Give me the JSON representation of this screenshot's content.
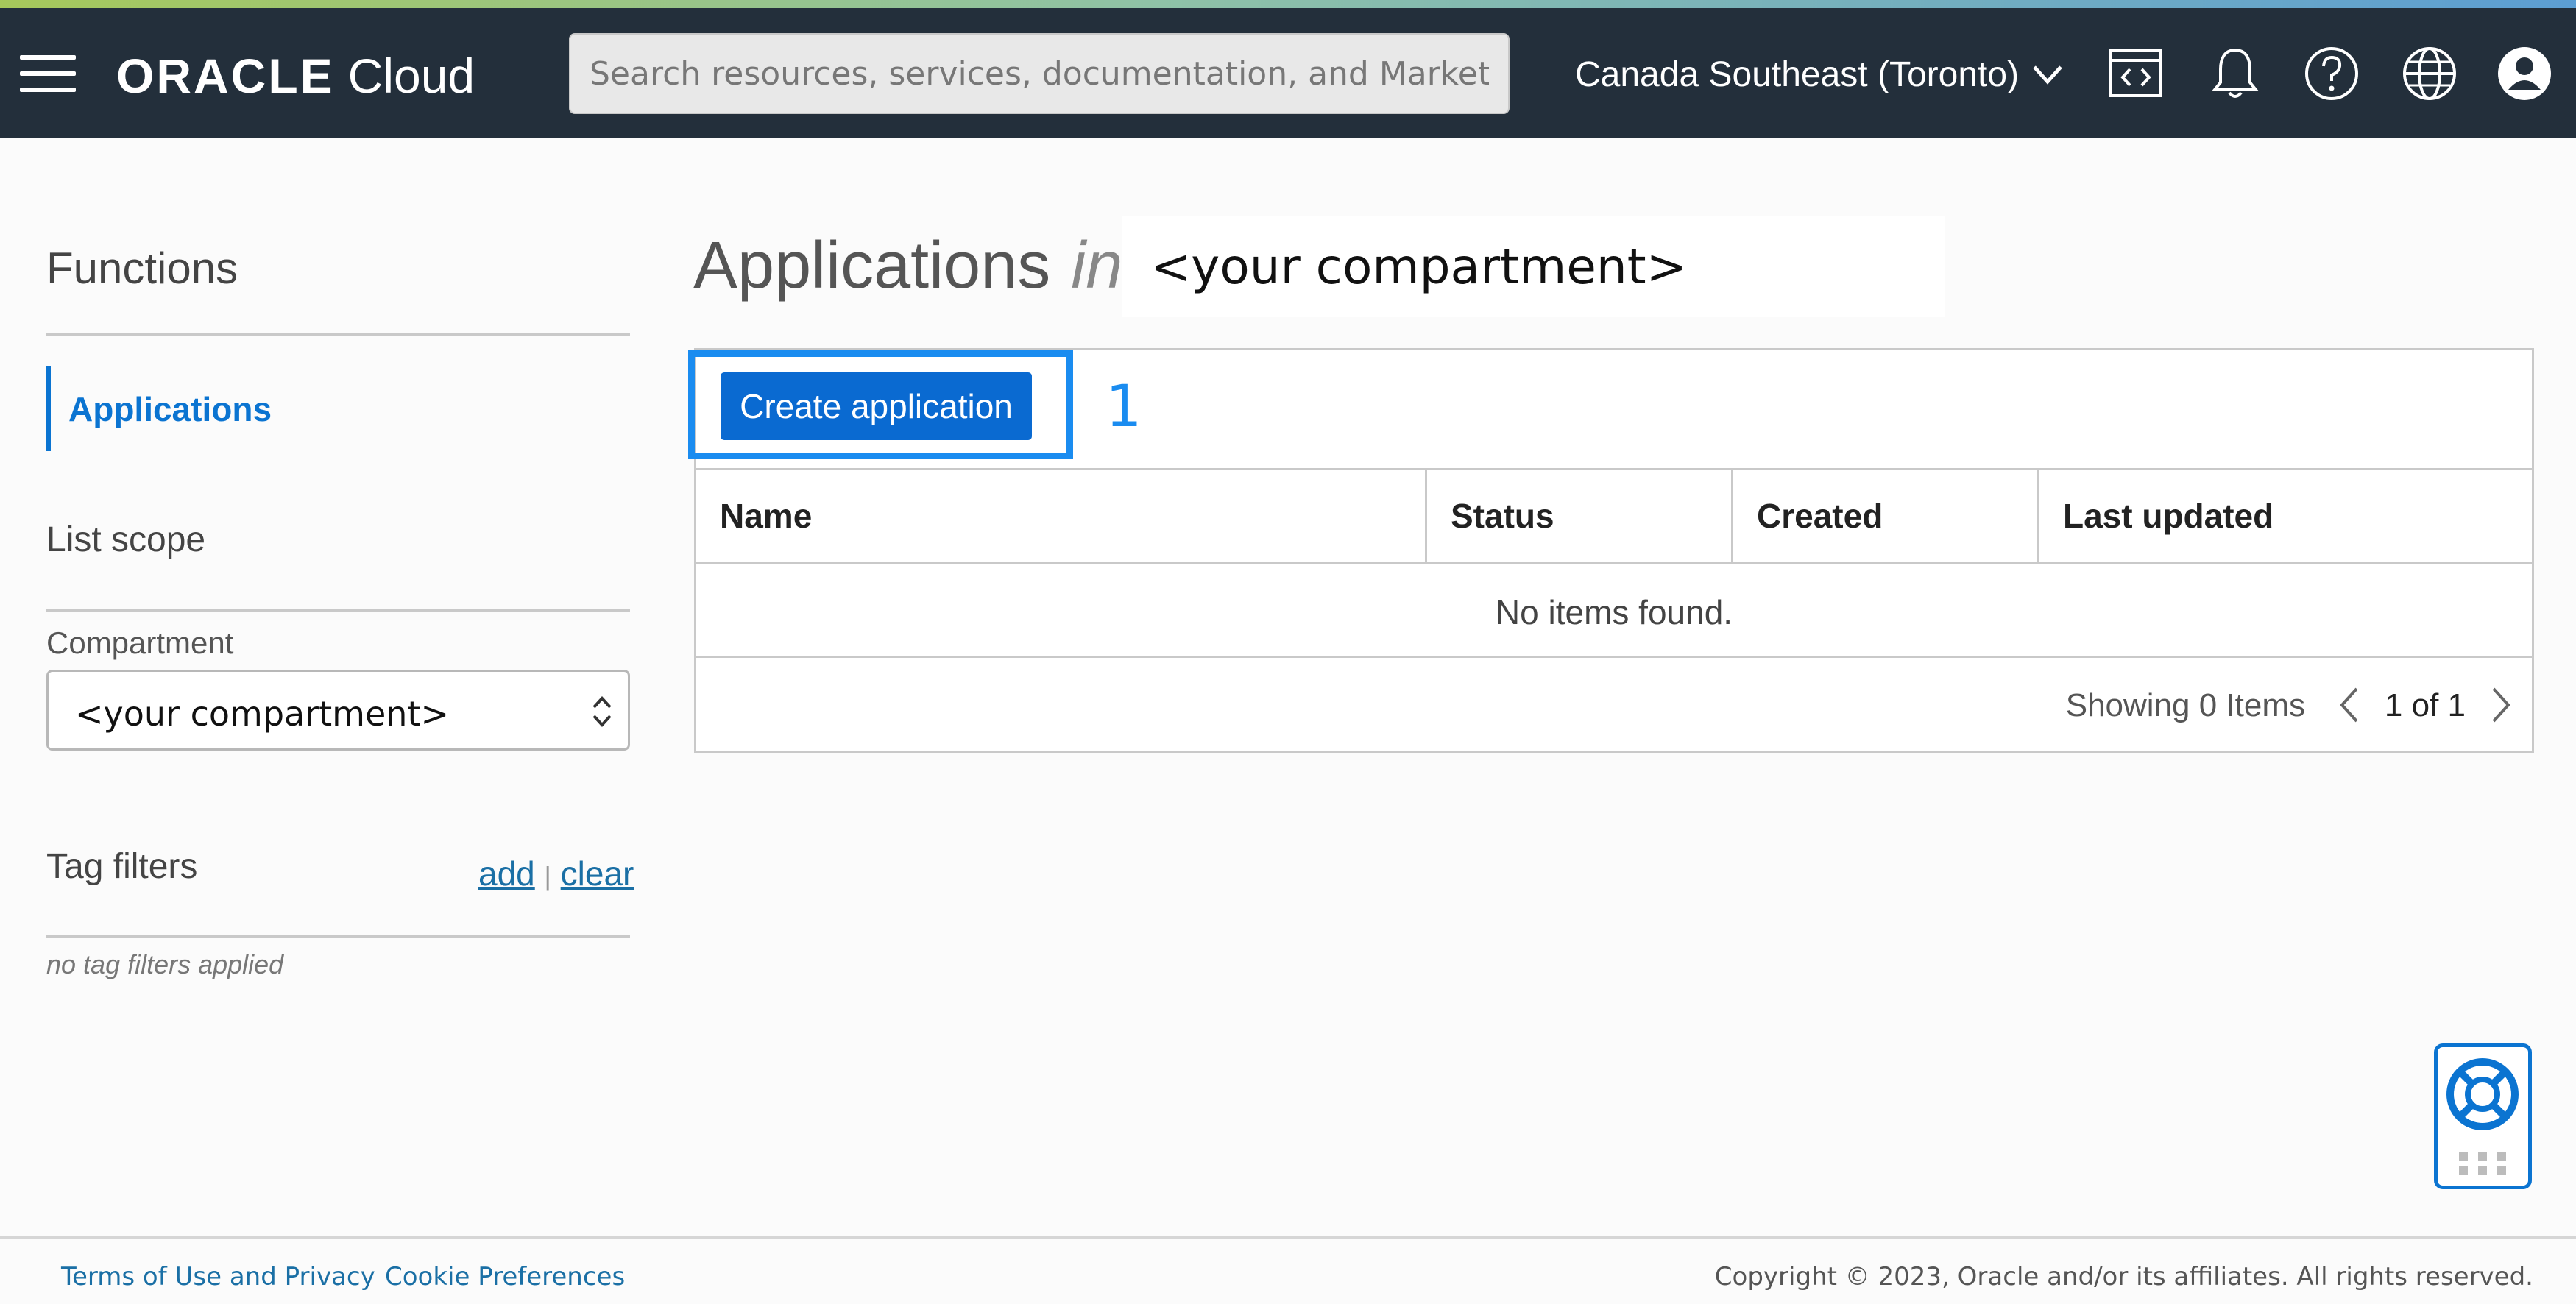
{
  "header": {
    "logo_text": "ORACLE",
    "logo_product": "Cloud",
    "search_placeholder": "Search resources, services, documentation, and Marketplace",
    "region": "Canada Southeast (Toronto)",
    "icons": [
      "code-editor-icon",
      "bell-icon",
      "help-icon",
      "globe-icon",
      "user-icon"
    ]
  },
  "sidebar": {
    "section_title": "Functions",
    "active_item": "Applications",
    "list_scope_title": "List scope",
    "compartment_label": "Compartment",
    "compartment_value": "<your compartment>",
    "tag_filters_title": "Tag filters",
    "tag_add": "add",
    "tag_separator": "|",
    "tag_clear": "clear",
    "tag_empty": "no tag filters applied"
  },
  "main": {
    "title": "Applications",
    "title_in": "in",
    "compartment": "<your compartment>",
    "create_button": "Create application",
    "step_marker": "1",
    "columns": [
      "Name",
      "Status",
      "Created",
      "Last updated"
    ],
    "empty_message": "No items found.",
    "showing": "Showing 0 Items",
    "pagination": "1 of 1"
  },
  "footer": {
    "terms": "Terms of Use and Privacy",
    "cookies": "Cookie Preferences",
    "copyright": "Copyright © 2023, Oracle and/or its affiliates. All rights reserved."
  },
  "colors": {
    "topbar": "#232f3b",
    "accent": "#0b74d1",
    "highlight": "#1a8cf0"
  }
}
